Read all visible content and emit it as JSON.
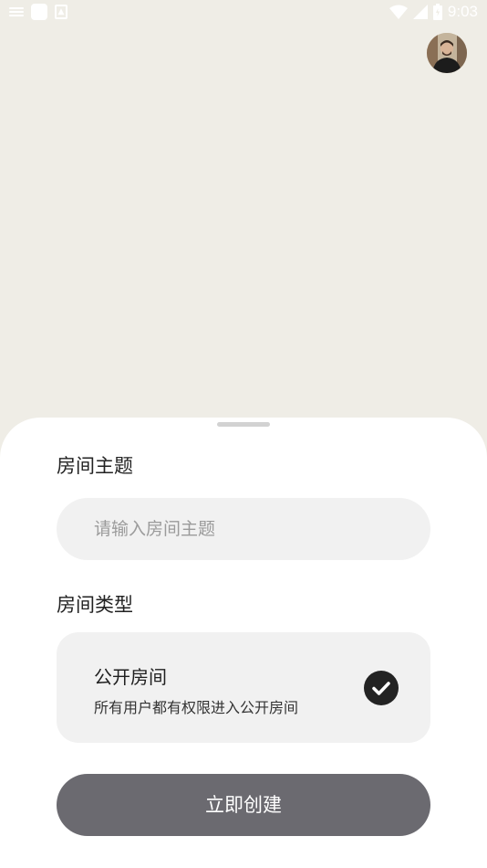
{
  "status_bar": {
    "time": "9:03",
    "icons": [
      "notification-lines-icon",
      "app-square-icon",
      "photo-icon",
      "wifi-icon",
      "signal-icon",
      "battery-icon"
    ]
  },
  "avatar": {
    "icon": "profile-photo"
  },
  "sheet": {
    "topic_label": "房间主题",
    "topic_input": {
      "placeholder": "请输入房间主题",
      "value": ""
    },
    "type_label": "房间类型",
    "option": {
      "title": "公开房间",
      "description": "所有用户都有权限进入公开房间",
      "selected": true,
      "icon": "checkmark-icon"
    },
    "create_button": "立即创建"
  },
  "colors": {
    "background": "#efede6",
    "sheet": "#ffffff",
    "input_bg": "#f1f1f1",
    "button": "#6b6a70",
    "check": "#232323"
  }
}
